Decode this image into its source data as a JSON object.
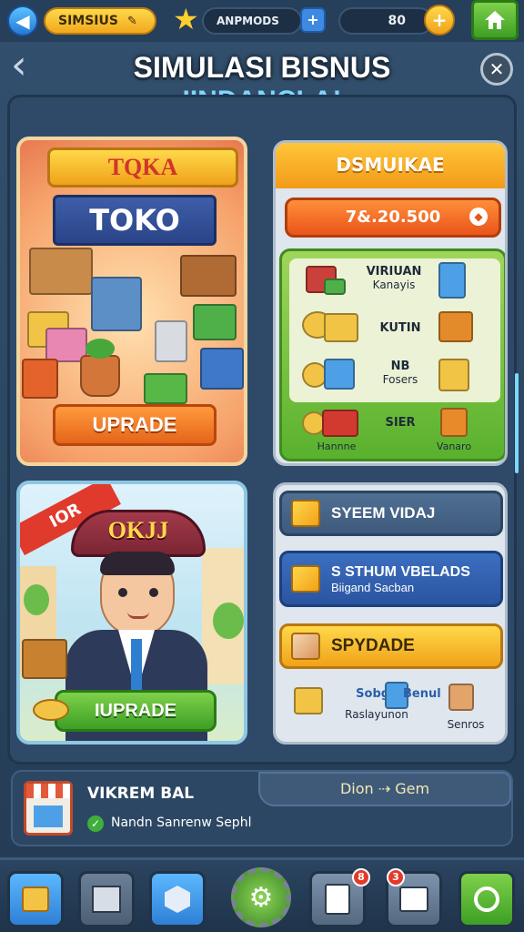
{
  "topbar": {
    "currency1_label": "SIMSIUS",
    "currency2_label": "ANPMODS",
    "currency3_value": "80",
    "plus": "+",
    "home_icon": "home-icon"
  },
  "header": {
    "title": "SIMULASI BISNUS",
    "subtitle": "IINDANCLA!",
    "back_symbol": "‹",
    "close_symbol": "✕"
  },
  "toko_card": {
    "ribbon": "TQKA",
    "plate": "TOKO",
    "upgrade_label": "UPRADE"
  },
  "stats_card": {
    "header": "DSMUIKAE",
    "value": "7&.20.500",
    "items": [
      {
        "title": "VIRIUAN",
        "sub": "Kanayis"
      },
      {
        "title": "KUTIN",
        "sub": ""
      },
      {
        "title": "NB",
        "sub": "Fosers"
      },
      {
        "title": "SIER",
        "sub": ""
      }
    ],
    "bottom_left": "Hannne",
    "bottom_right": "Vanaro"
  },
  "hero_card": {
    "flag": "IOR",
    "hat_text": "OKJJ",
    "upgrade_label": "IUPRADE"
  },
  "list_card": {
    "items": [
      {
        "title": "SYEEM VIDAJ",
        "sub": ""
      },
      {
        "title": "S STHUM VBELADS",
        "sub": "Biigand Sacban"
      },
      {
        "title": "SPYDADE",
        "sub": ""
      }
    ],
    "footer_left_title": "Sobga",
    "footer_left_sub": "Raslayunon",
    "footer_mid": "Benul",
    "footer_right": "Senros"
  },
  "info_bar": {
    "name": "VIKREM BAL",
    "status": "Nandn Sanrenw Sephl",
    "button": "Dion ⇢ Gem"
  },
  "nav": {
    "badge1": "8",
    "badge2": "3"
  },
  "colors": {
    "accent_orange": "#e9541a",
    "accent_green": "#3d9f25",
    "accent_gold": "#f2a81d",
    "panel": "#2e4a68"
  }
}
